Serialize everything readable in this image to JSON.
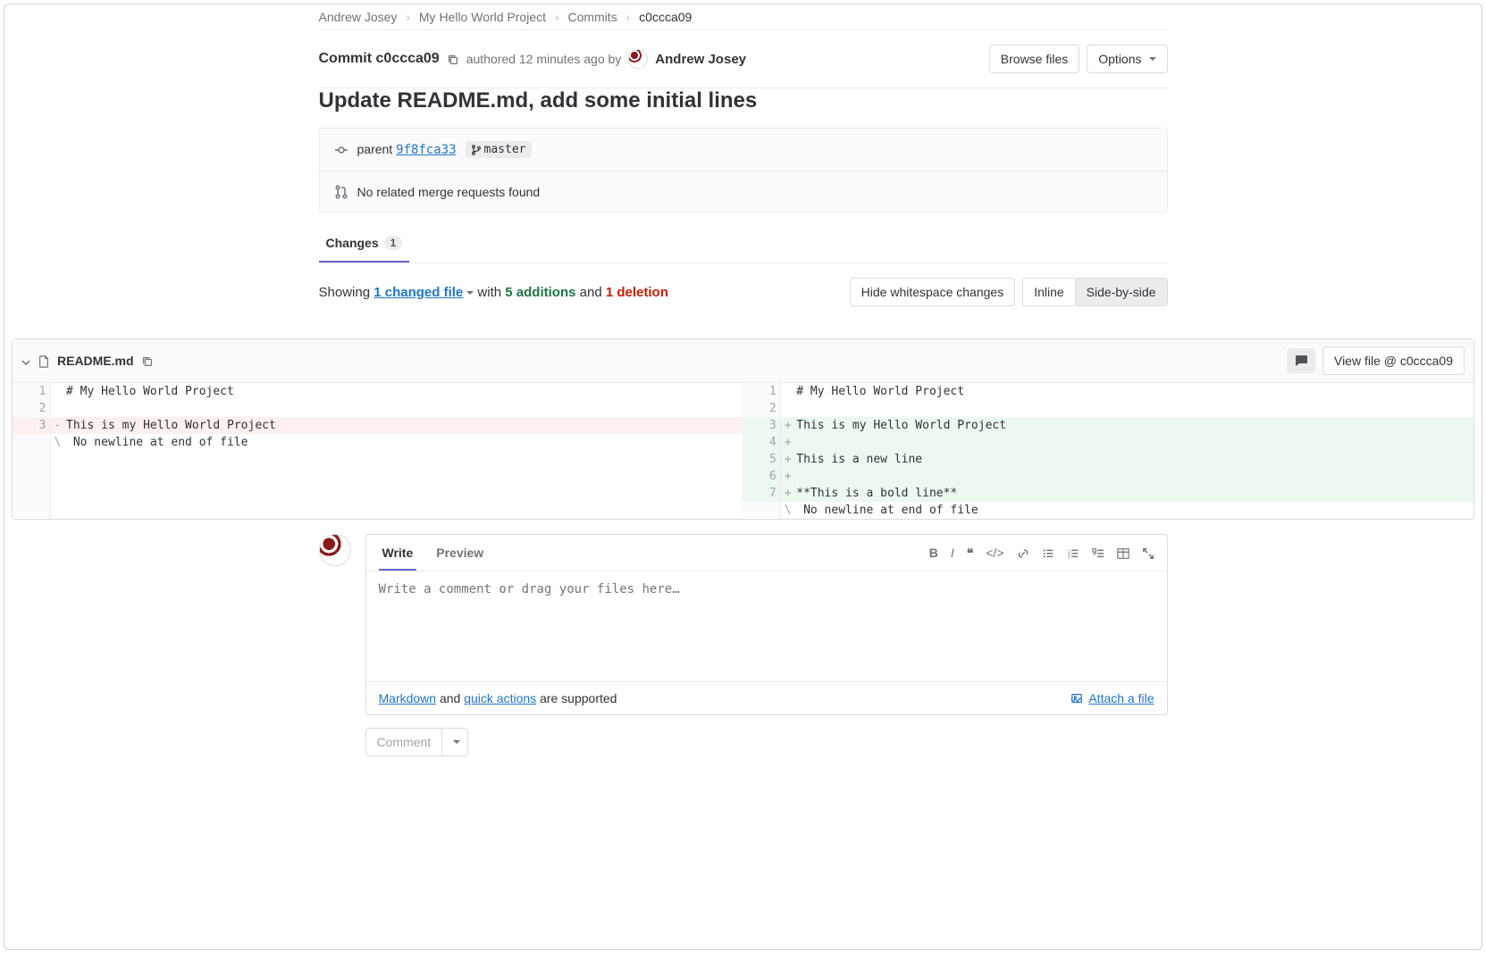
{
  "breadcrumb": {
    "owner": "Andrew Josey",
    "project": "My Hello World Project",
    "section": "Commits",
    "current": "c0ccca09"
  },
  "header": {
    "commit_label": "Commit",
    "sha_short": "c0ccca09",
    "authored_prefix": "authored",
    "time_ago": "12 minutes ago",
    "by": "by",
    "author": "Andrew Josey",
    "browse_files": "Browse files",
    "options": "Options"
  },
  "commit_title": "Update README.md, add some initial lines",
  "parent": {
    "label": "parent",
    "sha": "9f8fca33",
    "branch": "master",
    "mr_text": "No related merge requests found"
  },
  "tabs": {
    "changes": "Changes",
    "count": "1"
  },
  "summary": {
    "showing": "Showing",
    "changed": "1 changed file",
    "with": "with",
    "additions": "5 additions",
    "and": "and",
    "deletions": "1 deletion",
    "hide_ws": "Hide whitespace changes",
    "inline": "Inline",
    "side_by_side": "Side-by-side"
  },
  "file": {
    "name": "README.md",
    "view_file": "View file @ c0ccca09"
  },
  "diff": {
    "left": [
      {
        "n": "1",
        "sign": "",
        "text": "# My Hello World Project",
        "cls": "ctx"
      },
      {
        "n": "2",
        "sign": "",
        "text": "",
        "cls": "ctx"
      },
      {
        "n": "3",
        "sign": "-",
        "text": "This is my Hello World Project",
        "cls": "del"
      },
      {
        "n": "",
        "sign": "\\",
        "text": " No newline at end of file",
        "cls": "meta-line"
      }
    ],
    "right": [
      {
        "n": "1",
        "sign": "",
        "text": "# My Hello World Project",
        "cls": "ctx"
      },
      {
        "n": "2",
        "sign": "",
        "text": "",
        "cls": "ctx"
      },
      {
        "n": "3",
        "sign": "+",
        "text": "This is my Hello World Project",
        "cls": "add"
      },
      {
        "n": "4",
        "sign": "+",
        "text": "",
        "cls": "add"
      },
      {
        "n": "5",
        "sign": "+",
        "text": "This is a new line",
        "cls": "add"
      },
      {
        "n": "6",
        "sign": "+",
        "text": "",
        "cls": "add"
      },
      {
        "n": "7",
        "sign": "+",
        "text": "**This is a bold line**",
        "cls": "add"
      },
      {
        "n": "",
        "sign": "\\",
        "text": " No newline at end of file",
        "cls": "meta-line"
      }
    ]
  },
  "comment": {
    "write": "Write",
    "preview": "Preview",
    "placeholder": "Write a comment or drag your files here…",
    "markdown": "Markdown",
    "and": "and",
    "quick_actions": "quick actions",
    "supported": "are supported",
    "attach": "Attach a file",
    "submit": "Comment"
  }
}
